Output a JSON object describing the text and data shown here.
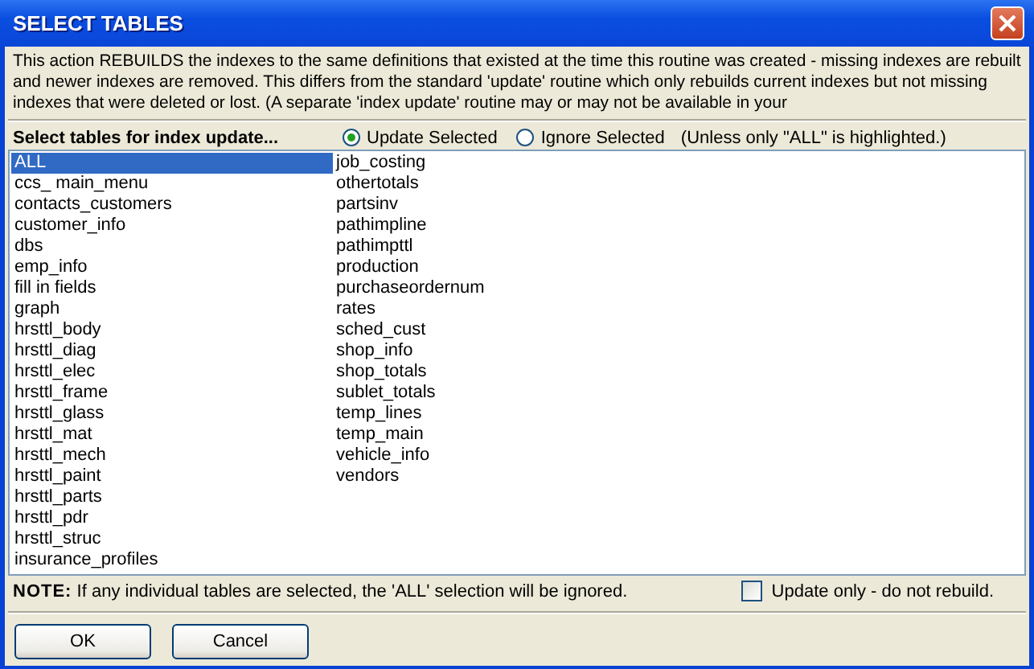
{
  "window": {
    "title": "SELECT TABLES"
  },
  "description": "This action REBUILDS the indexes to the same definitions that existed at the time this routine was created - missing indexes are rebuilt and newer indexes are removed. This differs from the standard 'update' routine which only rebuilds current indexes but not missing indexes that were deleted or lost. (A separate 'index update' routine may or may not be available in your",
  "prompt": "Select tables for index update...",
  "radios": [
    {
      "label": "Update Selected",
      "selected": true
    },
    {
      "label": "Ignore Selected",
      "selected": false
    }
  ],
  "radio_hint": "(Unless only \"ALL\" is highlighted.)",
  "tables": [
    {
      "label": "ALL",
      "selected": true
    },
    {
      "label": "ccs_ main_menu",
      "selected": false
    },
    {
      "label": "contacts_customers",
      "selected": false
    },
    {
      "label": "customer_info",
      "selected": false
    },
    {
      "label": "dbs",
      "selected": false
    },
    {
      "label": "emp_info",
      "selected": false
    },
    {
      "label": "fill in fields",
      "selected": false
    },
    {
      "label": "graph",
      "selected": false
    },
    {
      "label": "hrsttl_body",
      "selected": false
    },
    {
      "label": "hrsttl_diag",
      "selected": false
    },
    {
      "label": "hrsttl_elec",
      "selected": false
    },
    {
      "label": "hrsttl_frame",
      "selected": false
    },
    {
      "label": "hrsttl_glass",
      "selected": false
    },
    {
      "label": "hrsttl_mat",
      "selected": false
    },
    {
      "label": "hrsttl_mech",
      "selected": false
    },
    {
      "label": "hrsttl_paint",
      "selected": false
    },
    {
      "label": "hrsttl_parts",
      "selected": false
    },
    {
      "label": "hrsttl_pdr",
      "selected": false
    },
    {
      "label": "hrsttl_struc",
      "selected": false
    },
    {
      "label": "insurance_profiles",
      "selected": false
    },
    {
      "label": "job_costing",
      "selected": false
    },
    {
      "label": "othertotals",
      "selected": false
    },
    {
      "label": "partsinv",
      "selected": false
    },
    {
      "label": "pathimpline",
      "selected": false
    },
    {
      "label": "pathimpttl",
      "selected": false
    },
    {
      "label": "production",
      "selected": false
    },
    {
      "label": "purchaseordernum",
      "selected": false
    },
    {
      "label": "rates",
      "selected": false
    },
    {
      "label": "sched_cust",
      "selected": false
    },
    {
      "label": "shop_info",
      "selected": false
    },
    {
      "label": "shop_totals",
      "selected": false
    },
    {
      "label": "sublet_totals",
      "selected": false
    },
    {
      "label": "temp_lines",
      "selected": false
    },
    {
      "label": "temp_main",
      "selected": false
    },
    {
      "label": "vehicle_info",
      "selected": false
    },
    {
      "label": "vendors",
      "selected": false
    }
  ],
  "note": "**NOTE:**  If any individual tables are selected, the 'ALL' selection will be ignored.",
  "update_only": {
    "label": "Update only - do not rebuild.",
    "checked": false
  },
  "buttons": [
    "OK",
    "Cancel"
  ]
}
